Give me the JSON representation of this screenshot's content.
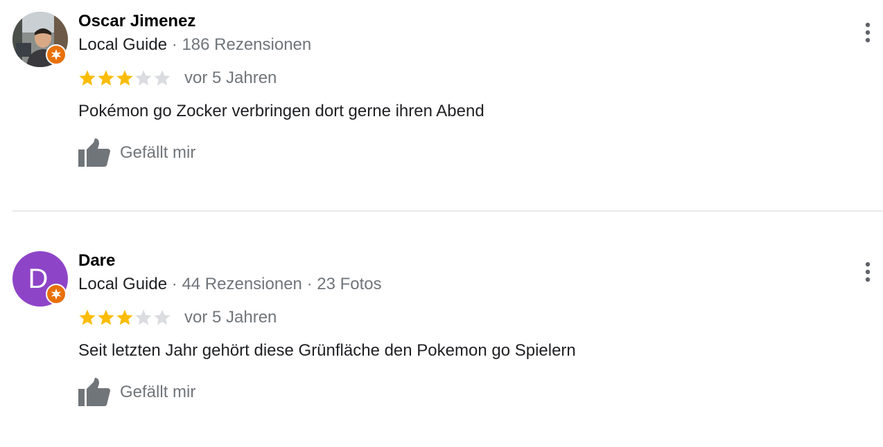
{
  "reviews": [
    {
      "author": "Oscar Jimenez",
      "avatar": {
        "type": "photo",
        "icon": "user-photo"
      },
      "guide_label": "Local Guide",
      "separator": "·",
      "review_count": "186 Rezensionen",
      "photo_count": "",
      "rating": 3,
      "max_rating": 5,
      "date": "vor 5 Jahren",
      "text": "Pokémon go Zocker verbringen dort gerne ihren Abend",
      "like_label": "Gefällt mir"
    },
    {
      "author": "Dare",
      "avatar": {
        "type": "letter",
        "letter": "D",
        "color": "#8e44c7"
      },
      "guide_label": "Local Guide",
      "separator": "·",
      "review_count": "44 Rezensionen",
      "photo_count": "23 Fotos",
      "rating": 3,
      "max_rating": 5,
      "date": "vor 5 Jahren",
      "text": "Seit letzten Jahr gehört diese Grünfläche den Pokemon go Spielern",
      "like_label": "Gefällt mir"
    }
  ],
  "colors": {
    "star_filled": "#fbbc04",
    "star_empty": "#dadce0",
    "badge": "#e8710a",
    "secondary_text": "#70757a",
    "divider": "#e8eaed"
  }
}
